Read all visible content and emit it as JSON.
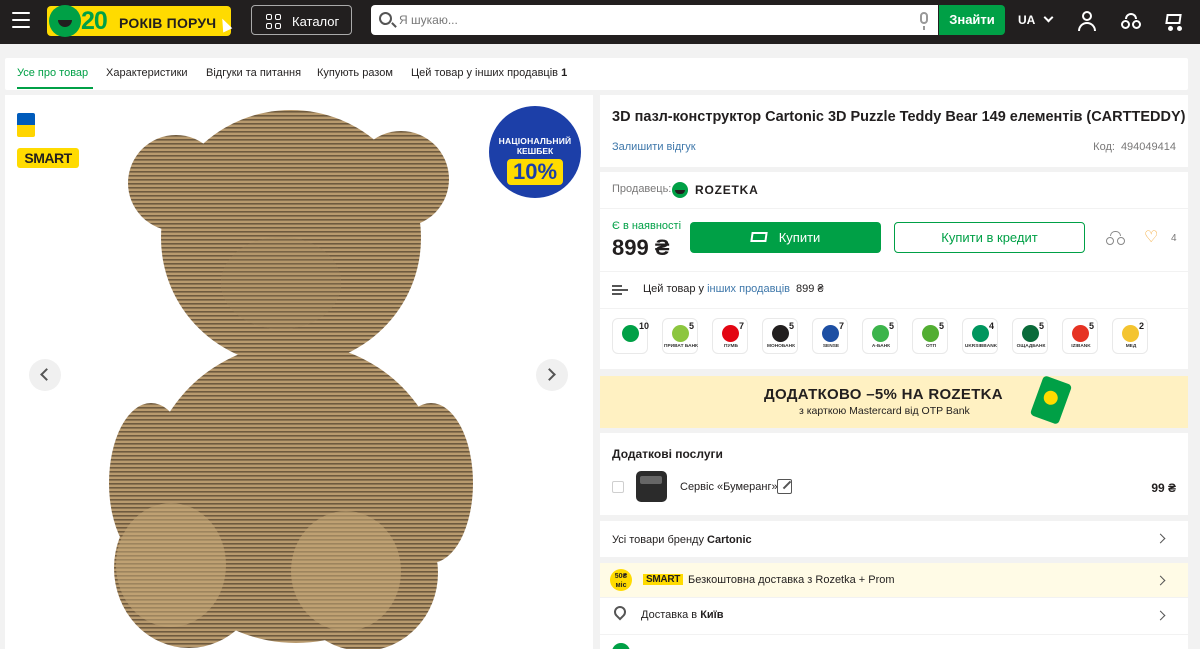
{
  "header": {
    "logo_number": "20",
    "logo_text": "РОКІВ ПОРУЧ",
    "catalog_label": "Каталог",
    "search_placeholder": "Я шукаю...",
    "search_button": "Знайти",
    "language": "UA",
    "icons": [
      "menu-icon",
      "search-icon",
      "microphone-icon",
      "chevron-down-icon",
      "user-icon",
      "compare-icon",
      "cart-icon"
    ]
  },
  "tabs": [
    {
      "label": "Усе про товар",
      "active": true
    },
    {
      "label": "Характеристики"
    },
    {
      "label": "Відгуки та питання"
    },
    {
      "label": "Купують разом"
    },
    {
      "label": "Цей товар у інших продавців",
      "count": "1"
    }
  ],
  "gallery": {
    "badge": "SMART",
    "cashback_line1": "НАЦІОНАЛЬНИЙ",
    "cashback_line2": "КЕШБЕК",
    "cashback_value": "10%",
    "image": "cardboard-teddy-bear-image"
  },
  "product": {
    "title": "3D пазл-конструктор Cartonic 3D Puzzle Teddy Bear 149 елементів (CARTTEDDY)",
    "review_link": "Залишити відгук",
    "code_label": "Код:",
    "code_value": "494049414",
    "seller_label": "Продавець:",
    "seller_name": "ROZETKA",
    "availability": "Є в наявності",
    "price": "899 ₴",
    "buy_label": "Купити",
    "credit_label": "Купити в кредит",
    "favorites_count": "4",
    "other_sellers_prefix": "Цей товар у",
    "other_sellers_link": "інших продавців",
    "other_sellers_price": "899 ₴"
  },
  "banks": [
    {
      "name": "",
      "count": "10",
      "color": "#00a046"
    },
    {
      "name": "ПРИВАТ БАНК",
      "count": "5",
      "color": "#8cc63f"
    },
    {
      "name": "ПУМБ",
      "count": "7",
      "color": "#e30613"
    },
    {
      "name": "МОНОБАНК",
      "count": "5",
      "color": "#221f1f"
    },
    {
      "name": "SENSE",
      "count": "7",
      "color": "#1d4fa3"
    },
    {
      "name": "А-БАНК",
      "count": "5",
      "color": "#3cb44b"
    },
    {
      "name": "ОТП",
      "count": "5",
      "color": "#52ae32"
    },
    {
      "name": "UKRSIBBANK",
      "count": "4",
      "color": "#00965e"
    },
    {
      "name": "ОЩАДБАНК",
      "count": "5",
      "color": "#0a6b3a"
    },
    {
      "name": "IZIBANK",
      "count": "5",
      "color": "#e63323"
    },
    {
      "name": "МЕД",
      "count": "2",
      "color": "#f4c430"
    }
  ],
  "promo": {
    "title": "ДОДАТКОВО –5% НА ROZETKA",
    "subtitle": "з карткою Mastercard від OTP Bank"
  },
  "services": {
    "title": "Додаткові послуги",
    "item_name": "Сервіс «Бумеранг»",
    "item_price": "99 ₴"
  },
  "brand_row": {
    "prefix": "Усі товари бренду",
    "brand": "Cartonic"
  },
  "smart_row": {
    "circle_top": "50₴",
    "circle_bottom": "міс",
    "badge": "SMART",
    "text": "Безкоштовна доставка з Rozetka + Prom"
  },
  "delivery_row": {
    "prefix": "Доставка в",
    "city": "Київ"
  }
}
